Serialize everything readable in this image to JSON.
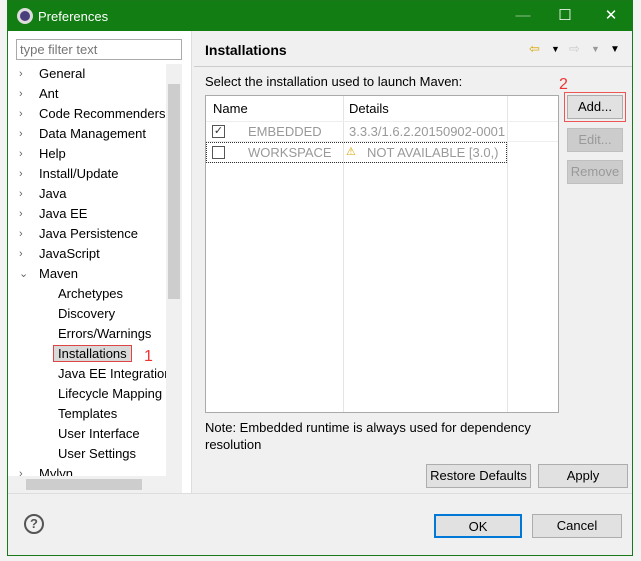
{
  "window": {
    "title": "Preferences",
    "min": "—",
    "max": "☐",
    "close": "✕"
  },
  "filter": {
    "placeholder": "type filter text"
  },
  "tree": [
    {
      "label": "General",
      "level": 0,
      "arrow": "›"
    },
    {
      "label": "Ant",
      "level": 0,
      "arrow": "›"
    },
    {
      "label": "Code Recommenders",
      "level": 0,
      "arrow": "›"
    },
    {
      "label": "Data Management",
      "level": 0,
      "arrow": "›"
    },
    {
      "label": "Help",
      "level": 0,
      "arrow": "›"
    },
    {
      "label": "Install/Update",
      "level": 0,
      "arrow": "›"
    },
    {
      "label": "Java",
      "level": 0,
      "arrow": "›"
    },
    {
      "label": "Java EE",
      "level": 0,
      "arrow": "›"
    },
    {
      "label": "Java Persistence",
      "level": 0,
      "arrow": "›"
    },
    {
      "label": "JavaScript",
      "level": 0,
      "arrow": "›"
    },
    {
      "label": "Maven",
      "level": 0,
      "arrow": "⌄"
    },
    {
      "label": "Archetypes",
      "level": 1
    },
    {
      "label": "Discovery",
      "level": 1
    },
    {
      "label": "Errors/Warnings",
      "level": 1
    },
    {
      "label": "Installations",
      "level": 1,
      "selected": true
    },
    {
      "label": "Java EE Integration",
      "level": 1
    },
    {
      "label": "Lifecycle Mapping",
      "level": 1
    },
    {
      "label": "Templates",
      "level": 1
    },
    {
      "label": "User Interface",
      "level": 1
    },
    {
      "label": "User Settings",
      "level": 1
    },
    {
      "label": "Mylyn",
      "level": 0,
      "arrow": "›"
    }
  ],
  "page": {
    "title": "Installations",
    "instruction": "Select the installation used to launch Maven:",
    "columns": [
      "Name",
      "Details"
    ],
    "rows": [
      {
        "checked": true,
        "name": "EMBEDDED",
        "details": "3.3.3/1.6.2.20150902-0001",
        "warning": false
      },
      {
        "checked": false,
        "name": "WORKSPACE",
        "details": "NOT AVAILABLE [3.0,)",
        "warning": true
      }
    ],
    "buttons": {
      "add": "Add...",
      "edit": "Edit...",
      "remove": "Remove"
    },
    "note": "Note: Embedded runtime is always used for dependency resolution",
    "restore": "Restore Defaults",
    "apply": "Apply"
  },
  "annotations": {
    "one": "1",
    "two": "2"
  },
  "footer": {
    "help": "?",
    "ok": "OK",
    "cancel": "Cancel"
  },
  "colors": {
    "titlebar": "#127d12",
    "annotation": "#e33333"
  }
}
